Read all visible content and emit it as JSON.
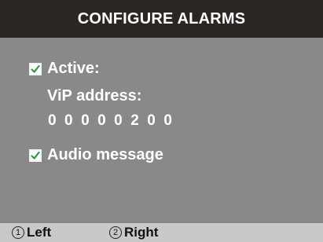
{
  "title": "CONFIGURE ALARMS",
  "options": [
    {
      "label": "Active:",
      "checked": true,
      "icon": "checkmark-icon"
    },
    {
      "label": "Audio message",
      "checked": true,
      "icon": "checkmark-icon"
    }
  ],
  "vip_address": {
    "label": "ViP address:",
    "value": "0 0 0 0 0 2 0 0"
  },
  "softkeys": [
    {
      "number": "1",
      "label": "Left"
    },
    {
      "number": "2",
      "label": "Right"
    }
  ],
  "colors": {
    "title_bg": "#2b2624",
    "screen_bg": "#898989",
    "footer_bg": "#c9c9c9",
    "check": "#2e9a3a"
  }
}
